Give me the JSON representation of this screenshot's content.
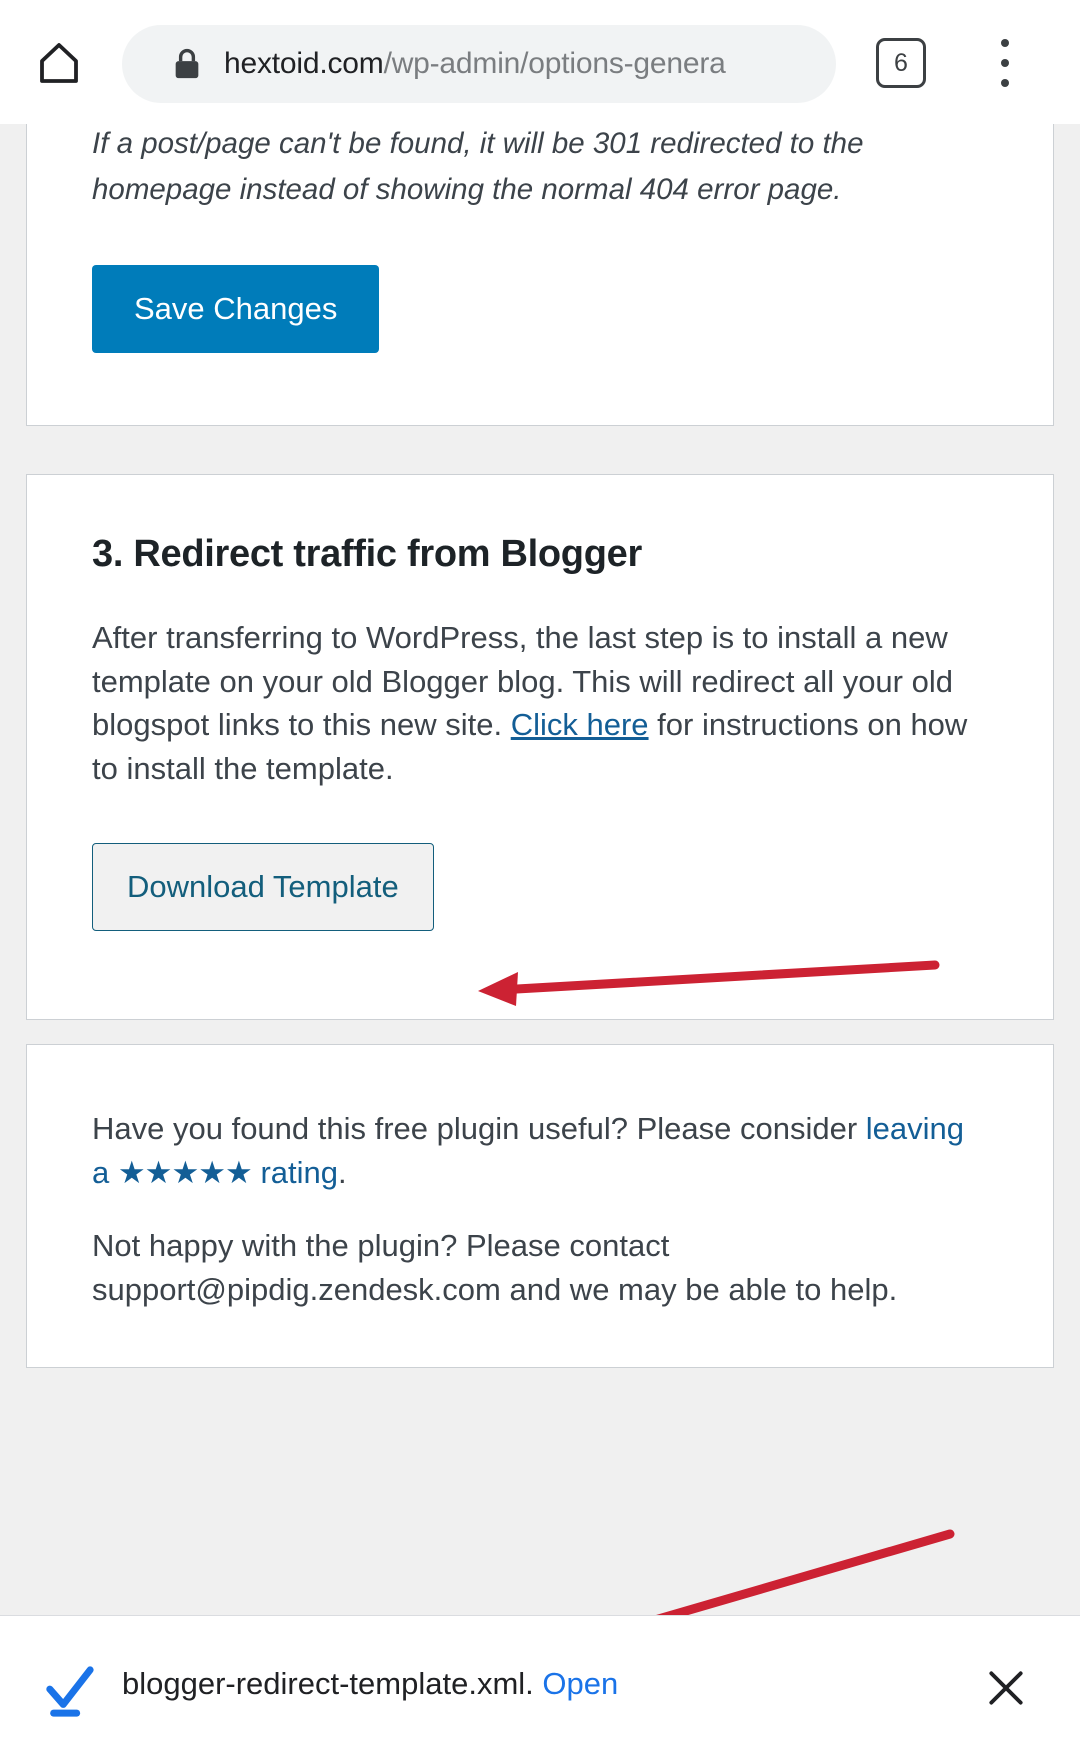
{
  "browser": {
    "home_icon": "home-icon",
    "lock_icon": "lock-icon",
    "url_domain": "hextoid.com",
    "url_path": "/wp-admin/options-genera",
    "tab_count": "6",
    "menu_icon": "kebab-menu-icon"
  },
  "page": {
    "card_settings": {
      "note_text": "If a post/page can't be found, it will be 301 redirected to the homepage instead of showing the normal 404 error page.",
      "save_button": "Save Changes"
    },
    "card_redirect": {
      "heading": "3. Redirect traffic from Blogger",
      "paragraph_part1": "After transferring to WordPress, the last step is to install a new template on your old Blogger blog. This will redirect all your old blogspot links to this new site. ",
      "paragraph_link": "Click here",
      "paragraph_part2": " for instructions on how to install the template.",
      "download_button": "Download Template"
    },
    "card_feedback": {
      "line1_part1": "Have you found this free plugin useful? Please consider ",
      "line1_link_pre": "leaving a ",
      "line1_stars": "★★★★★",
      "line1_link_post": " rating",
      "line1_period": ".",
      "line2": "Not happy with the plugin? Please contact support@pipdig.zendesk.com and we may be able to help."
    }
  },
  "annotations": {
    "arrow_download": "red-arrow-pointing-to-download-template",
    "arrow_shelf": "red-arrow-pointing-to-download-shelf",
    "arrow_color": "#cc2233"
  },
  "download_shelf": {
    "check_icon": "download-complete-check-icon",
    "filename": "blogger-redirect-template.xml.",
    "open_label": "Open",
    "close_icon": "close-icon"
  }
}
